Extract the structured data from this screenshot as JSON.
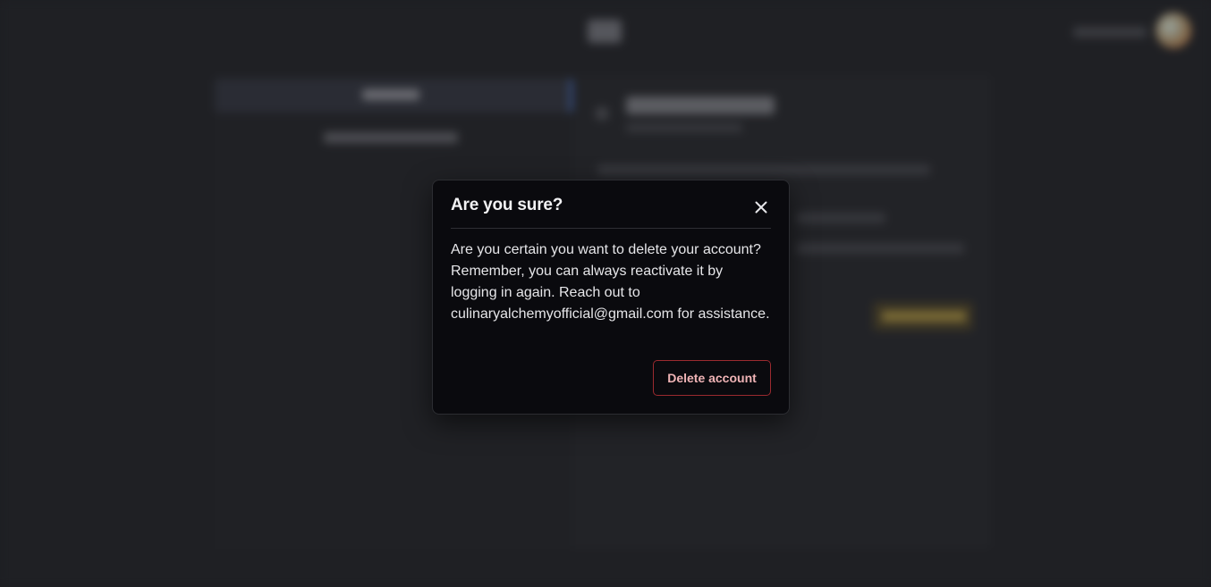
{
  "modal": {
    "title": "Are you sure?",
    "message": "Are you certain you want to delete your account? Remember, you can always reactivate it by logging in again. Reach out to culinaryalchemyofficial@gmail.com for assistance.",
    "close_icon": "close-icon",
    "confirm_label": "Delete account"
  },
  "colors": {
    "modal_background": "#0a0a0e",
    "danger_border": "#9b2a2f",
    "danger_text": "#f0b4b6",
    "page_background": "#1f2024"
  }
}
